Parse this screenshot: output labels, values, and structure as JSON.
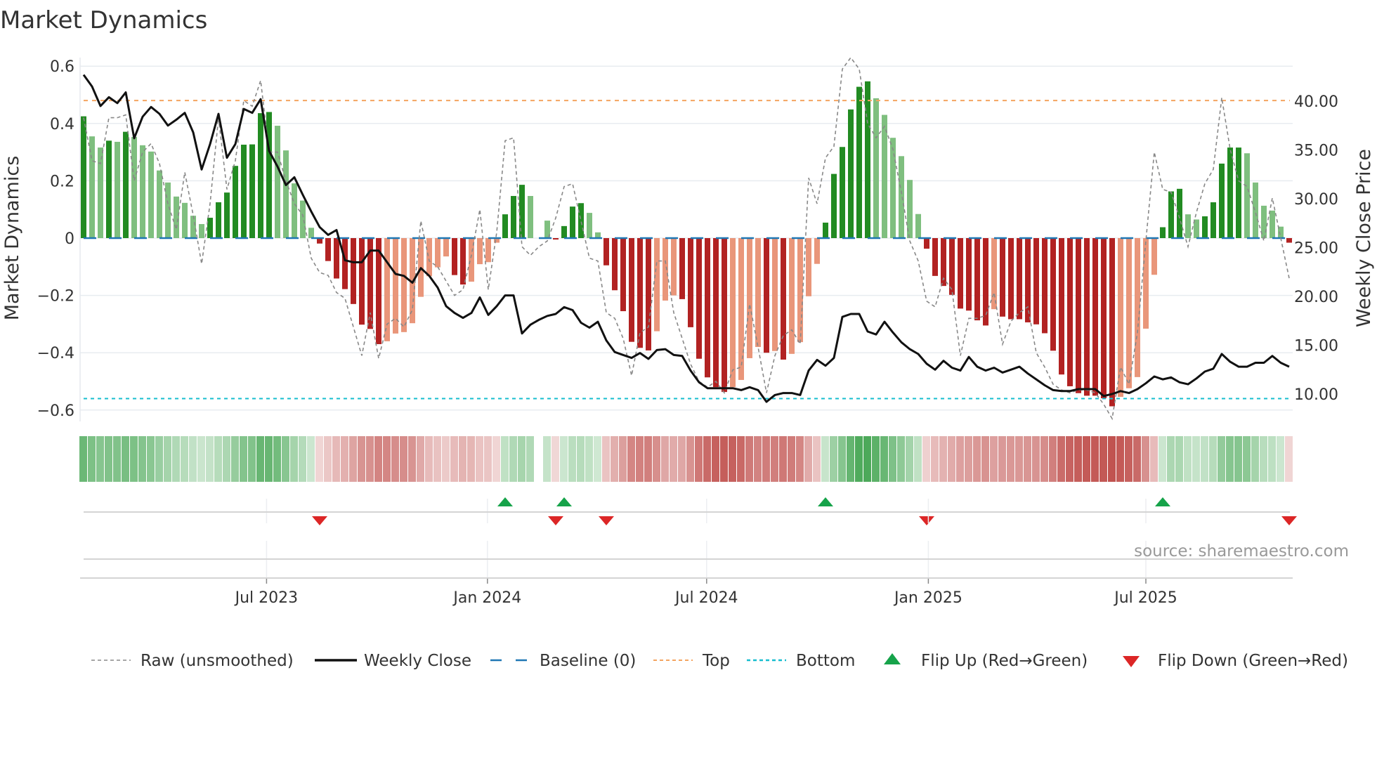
{
  "title": "Market Dynamics",
  "source": "source: sharemaestro.com",
  "legend": [
    {
      "key": "raw",
      "label": "Raw (unsmoothed)"
    },
    {
      "key": "close",
      "label": "Weekly Close"
    },
    {
      "key": "baseline",
      "label": "Baseline (0)"
    },
    {
      "key": "top",
      "label": "Top"
    },
    {
      "key": "bottom",
      "label": "Bottom"
    },
    {
      "key": "flip_up",
      "label": "Flip Up (Red→Green)"
    },
    {
      "key": "flip_down",
      "label": "Flip Down (Green→Red)"
    }
  ],
  "colors": {
    "pos_strong": "#228b22",
    "pos_weak": "#7fbf7f",
    "neg_strong": "#b22222",
    "neg_weak": "#e9967a",
    "strip_pos": "#3fa34d",
    "strip_neg": "#c0504d",
    "baseline": "#1f77b4",
    "top": "#f4a460",
    "bottom": "#17becf",
    "flip_up": "#16a34a",
    "flip_down": "#dc2626",
    "raw": "#888888",
    "close": "#111111",
    "grid": "#e8ecf0"
  },
  "chart_data": {
    "type": "bar",
    "title": "Market Dynamics",
    "ylabel": "Market Dynamics",
    "y2label": "Weekly Close Price",
    "ylim": [
      -0.65,
      0.65
    ],
    "y2lim": [
      7,
      45
    ],
    "yticks": [
      "0.6",
      "0.4",
      "0.2",
      "0",
      "−0.2",
      "−0.4",
      "−0.6"
    ],
    "ytick_values": [
      0.6,
      0.4,
      0.2,
      0,
      -0.2,
      -0.4,
      -0.6
    ],
    "y2ticks": [
      "40.00",
      "35.00",
      "30.00",
      "25.00",
      "20.00",
      "15.00",
      "10.00"
    ],
    "y2tick_values": [
      40,
      35,
      30,
      25,
      20,
      15,
      10
    ],
    "xticks": [
      {
        "label": "Jul 2023",
        "week": 22.7
      },
      {
        "label": "Jan 2024",
        "week": 48.9
      },
      {
        "label": "Jul 2024",
        "week": 74.9
      },
      {
        "label": "Jan 2025",
        "week": 101.2
      },
      {
        "label": "Jul 2025",
        "week": 127.0
      }
    ],
    "top_level": 0.48,
    "bottom_level": -0.56,
    "baseline": 0,
    "weeks": 144,
    "values": [
      0.425,
      0.355,
      0.316,
      0.34,
      0.336,
      0.371,
      0.353,
      0.324,
      0.302,
      0.236,
      0.194,
      0.145,
      0.123,
      0.078,
      0.049,
      0.071,
      0.125,
      0.159,
      0.252,
      0.326,
      0.327,
      0.436,
      0.44,
      0.392,
      0.306,
      0.191,
      0.131,
      0.036,
      -0.019,
      -0.08,
      -0.141,
      -0.178,
      -0.23,
      -0.302,
      -0.317,
      -0.37,
      -0.36,
      -0.333,
      -0.328,
      -0.297,
      -0.205,
      -0.133,
      -0.102,
      -0.064,
      -0.129,
      -0.162,
      -0.152,
      -0.091,
      -0.084,
      -0.016,
      0.083,
      0.147,
      0.186,
      0.147,
      null,
      0.061,
      -0.005,
      0.042,
      0.11,
      0.122,
      0.088,
      0.02,
      -0.095,
      -0.182,
      -0.255,
      -0.362,
      -0.383,
      -0.392,
      -0.325,
      -0.218,
      -0.2,
      -0.213,
      -0.311,
      -0.421,
      -0.486,
      -0.52,
      -0.537,
      -0.52,
      -0.495,
      -0.419,
      -0.38,
      -0.4,
      -0.394,
      -0.424,
      -0.404,
      -0.363,
      -0.203,
      -0.09,
      0.054,
      0.224,
      0.318,
      0.449,
      0.528,
      0.547,
      0.488,
      0.43,
      0.35,
      0.286,
      0.203,
      0.084,
      -0.037,
      -0.132,
      -0.167,
      -0.198,
      -0.246,
      -0.253,
      -0.287,
      -0.305,
      -0.248,
      -0.274,
      -0.283,
      -0.283,
      -0.294,
      -0.301,
      -0.332,
      -0.393,
      -0.476,
      -0.517,
      -0.541,
      -0.55,
      -0.55,
      -0.559,
      -0.587,
      -0.554,
      -0.524,
      -0.485,
      -0.316,
      -0.128,
      0.038,
      0.163,
      0.172,
      0.083,
      0.065,
      0.076,
      0.125,
      0.26,
      0.316,
      0.316,
      0.296,
      0.194,
      0.113,
      0.096,
      0.04,
      -0.016
    ],
    "raw": [
      0.42,
      0.27,
      0.26,
      0.42,
      0.42,
      0.43,
      0.2,
      0.3,
      0.33,
      0.26,
      0.12,
      0.03,
      0.23,
      0.08,
      -0.09,
      0.12,
      0.42,
      0.17,
      0.27,
      0.48,
      0.46,
      0.55,
      0.3,
      0.3,
      0.2,
      0.12,
      0.08,
      -0.07,
      -0.12,
      -0.13,
      -0.19,
      -0.21,
      -0.31,
      -0.41,
      -0.26,
      -0.42,
      -0.3,
      -0.28,
      -0.31,
      -0.25,
      0.06,
      -0.08,
      -0.1,
      -0.15,
      -0.2,
      -0.18,
      -0.06,
      0.1,
      -0.18,
      0.02,
      0.34,
      0.35,
      -0.03,
      -0.06,
      -0.03,
      -0.01,
      0.07,
      0.18,
      0.19,
      0.06,
      -0.07,
      -0.08,
      -0.26,
      -0.28,
      -0.35,
      -0.48,
      -0.33,
      -0.31,
      -0.08,
      -0.08,
      -0.26,
      -0.35,
      -0.44,
      -0.5,
      -0.52,
      -0.5,
      -0.54,
      -0.46,
      -0.45,
      -0.23,
      -0.38,
      -0.54,
      -0.41,
      -0.34,
      -0.32,
      -0.37,
      0.21,
      0.12,
      0.28,
      0.32,
      0.59,
      0.63,
      0.59,
      0.4,
      0.35,
      0.39,
      0.31,
      0.16,
      -0.01,
      -0.08,
      -0.22,
      -0.24,
      -0.14,
      -0.18,
      -0.41,
      -0.28,
      -0.28,
      -0.27,
      -0.19,
      -0.37,
      -0.29,
      -0.26,
      -0.24,
      -0.4,
      -0.45,
      -0.51,
      -0.53,
      -0.54,
      -0.53,
      -0.53,
      -0.54,
      -0.58,
      -0.63,
      -0.45,
      -0.51,
      -0.33,
      -0.01,
      0.3,
      0.17,
      0.16,
      0.07,
      -0.03,
      0.09,
      0.19,
      0.24,
      0.49,
      0.31,
      0.2,
      0.18,
      0.09,
      -0.01,
      0.14,
      0.0,
      -0.14
    ],
    "close": [
      42.7,
      41.5,
      39.5,
      40.4,
      39.8,
      40.9,
      36.2,
      38.4,
      39.4,
      38.7,
      37.5,
      38.1,
      38.8,
      36.8,
      33.0,
      35.6,
      38.7,
      34.2,
      35.6,
      39.2,
      38.8,
      40.2,
      34.9,
      33.3,
      31.4,
      32.2,
      30.4,
      28.7,
      27.1,
      26.3,
      26.8,
      23.7,
      23.5,
      23.5,
      24.7,
      24.7,
      23.5,
      22.3,
      22.1,
      21.4,
      22.9,
      22.1,
      20.9,
      19.0,
      18.3,
      17.8,
      18.3,
      19.9,
      18.1,
      19.0,
      20.1,
      20.1,
      16.2,
      17.1,
      17.6,
      18.0,
      18.2,
      18.9,
      18.6,
      17.3,
      16.8,
      17.4,
      15.5,
      14.3,
      14.0,
      13.7,
      14.2,
      13.6,
      14.5,
      14.6,
      14.0,
      13.9,
      12.4,
      11.2,
      10.6,
      10.6,
      10.6,
      10.6,
      10.4,
      10.7,
      10.4,
      9.2,
      9.9,
      10.1,
      10.1,
      9.9,
      12.4,
      13.5,
      12.9,
      13.7,
      17.9,
      18.2,
      18.2,
      16.4,
      16.1,
      17.4,
      16.3,
      15.3,
      14.6,
      14.1,
      13.1,
      12.5,
      13.4,
      12.7,
      12.4,
      13.8,
      12.8,
      12.4,
      12.7,
      12.2,
      12.5,
      12.8,
      12.1,
      11.5,
      10.9,
      10.4,
      10.3,
      10.3,
      10.5,
      10.5,
      10.5,
      9.8,
      10.0,
      10.3,
      10.1,
      10.5,
      11.1,
      11.8,
      11.5,
      11.7,
      11.2,
      11.0,
      11.6,
      12.3,
      12.6,
      14.1,
      13.3,
      12.8,
      12.8,
      13.2,
      13.2,
      13.9,
      13.2,
      12.8
    ],
    "flip_up_weeks": [
      51,
      58,
      89,
      129
    ],
    "flip_down_weeks": [
      29,
      57,
      63,
      101,
      144
    ],
    "legend_position": "bottom"
  }
}
